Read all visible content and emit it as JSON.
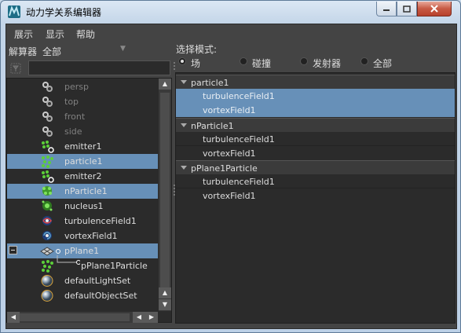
{
  "window": {
    "title": "动力学关系编辑器",
    "accent": "#6790b8",
    "close_color": "#c75a44"
  },
  "menubar": [
    "展示",
    "显示",
    "帮助"
  ],
  "left": {
    "solver_label": "解算器",
    "solver_value": "全部",
    "search_value": "",
    "items": [
      {
        "label": "persp",
        "icon": "camera-icon",
        "dim": true,
        "selected": false
      },
      {
        "label": "top",
        "icon": "camera-icon",
        "dim": true,
        "selected": false
      },
      {
        "label": "front",
        "icon": "camera-icon",
        "dim": true,
        "selected": false
      },
      {
        "label": "side",
        "icon": "camera-icon",
        "dim": true,
        "selected": false
      },
      {
        "label": "emitter1",
        "icon": "emitter-icon",
        "dim": false,
        "selected": false
      },
      {
        "label": "particle1",
        "icon": "particle-icon",
        "dim": false,
        "selected": true
      },
      {
        "label": "emitter2",
        "icon": "emitter-icon",
        "dim": false,
        "selected": false
      },
      {
        "label": "nParticle1",
        "icon": "nparticle-icon",
        "dim": false,
        "selected": true
      },
      {
        "label": "nucleus1",
        "icon": "nucleus-icon",
        "dim": false,
        "selected": false
      },
      {
        "label": "turbulenceField1",
        "icon": "turbulence-icon",
        "dim": false,
        "selected": false
      },
      {
        "label": "vortexField1",
        "icon": "vortex-icon",
        "dim": false,
        "selected": false
      },
      {
        "label": "pPlane1",
        "icon": "plane-icon",
        "dim": false,
        "selected": true
      },
      {
        "label": "pPlane1Particle",
        "icon": "particle-icon",
        "dim": false,
        "selected": false
      },
      {
        "label": "defaultLightSet",
        "icon": "set-icon",
        "dim": false,
        "selected": false
      },
      {
        "label": "defaultObjectSet",
        "icon": "set-icon",
        "dim": false,
        "selected": false
      }
    ]
  },
  "right": {
    "selection_mode_label": "选择模式:",
    "modes": [
      {
        "label": "场",
        "selected": true
      },
      {
        "label": "碰撞",
        "selected": false
      },
      {
        "label": "发射器",
        "selected": false
      },
      {
        "label": "全部",
        "selected": false
      }
    ],
    "groups": [
      {
        "name": "particle1",
        "children": [
          {
            "label": "turbulenceField1",
            "selected": true
          },
          {
            "label": "vortexField1",
            "selected": true
          }
        ]
      },
      {
        "name": "nParticle1",
        "children": [
          {
            "label": "turbulenceField1",
            "selected": false
          },
          {
            "label": "vortexField1",
            "selected": false
          }
        ]
      },
      {
        "name": "pPlane1Particle",
        "children": [
          {
            "label": "turbulenceField1",
            "selected": false
          },
          {
            "label": "vortexField1",
            "selected": false
          }
        ]
      }
    ]
  }
}
